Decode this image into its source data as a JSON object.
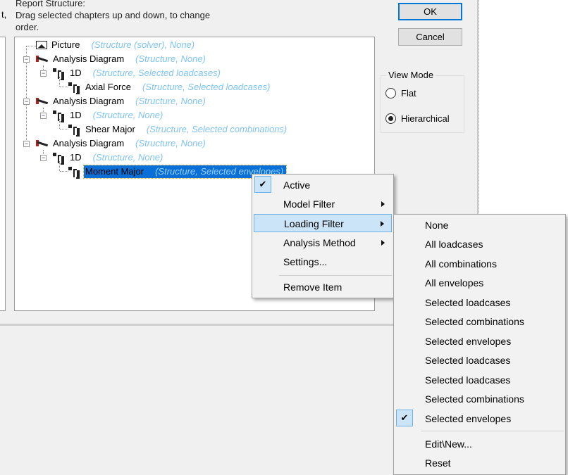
{
  "header": {
    "title": "Report Structure:",
    "instructions_line1": "Drag selected chapters up and down, to change",
    "instructions_line2": "order.",
    "left_fragment": "t,"
  },
  "buttons": {
    "ok": "OK",
    "cancel": "Cancel"
  },
  "view_mode": {
    "title": "View Mode",
    "options": [
      {
        "label": "Flat",
        "selected": false
      },
      {
        "label": "Hierarchical",
        "selected": true
      }
    ]
  },
  "tree": [
    {
      "label": "Picture",
      "meta": "(Structure (solver), None)",
      "icon": "picture-icon"
    },
    {
      "label": "Analysis Diagram",
      "meta": "(Structure, None)",
      "icon": "analysis-diagram-icon"
    },
    {
      "label": "1D",
      "meta": "(Structure, Selected loadcases)",
      "icon": "hierarchy-icon"
    },
    {
      "label": "Axial Force",
      "meta": "(Structure, Selected loadcases)",
      "icon": "hierarchy-icon"
    },
    {
      "label": "Analysis Diagram",
      "meta": "(Structure, None)",
      "icon": "analysis-diagram-icon"
    },
    {
      "label": "1D",
      "meta": "(Structure, None)",
      "icon": "hierarchy-icon"
    },
    {
      "label": "Shear Major",
      "meta": "(Structure, Selected combinations)",
      "icon": "hierarchy-icon"
    },
    {
      "label": "Analysis Diagram",
      "meta": "(Structure, None)",
      "icon": "analysis-diagram-icon"
    },
    {
      "label": "1D",
      "meta": "(Structure, None)",
      "icon": "hierarchy-icon"
    },
    {
      "label": "Moment Major",
      "meta": "(Structure, Selected envelopes)",
      "icon": "hierarchy-icon",
      "selected": true
    }
  ],
  "context_menu": {
    "items": [
      {
        "label": "Active",
        "checked": true
      },
      {
        "label": "Model Filter",
        "submenu": true
      },
      {
        "label": "Loading Filter",
        "submenu": true,
        "highlighted": true
      },
      {
        "label": "Analysis Method",
        "submenu": true
      },
      {
        "label": "Settings..."
      },
      {
        "label": "Remove Item"
      }
    ]
  },
  "loading_filter_menu": {
    "items": [
      {
        "label": "None"
      },
      {
        "label": "All loadcases"
      },
      {
        "label": "All combinations"
      },
      {
        "label": "All envelopes"
      },
      {
        "label": "Selected loadcases"
      },
      {
        "label": "Selected combinations"
      },
      {
        "label": "Selected envelopes"
      },
      {
        "label": "Selected loadcases"
      },
      {
        "label": "Selected loadcases"
      },
      {
        "label": "Selected combinations"
      },
      {
        "label": "Selected envelopes",
        "checked": true
      },
      {
        "label": "Edit\\New..."
      },
      {
        "label": "Reset"
      }
    ]
  }
}
